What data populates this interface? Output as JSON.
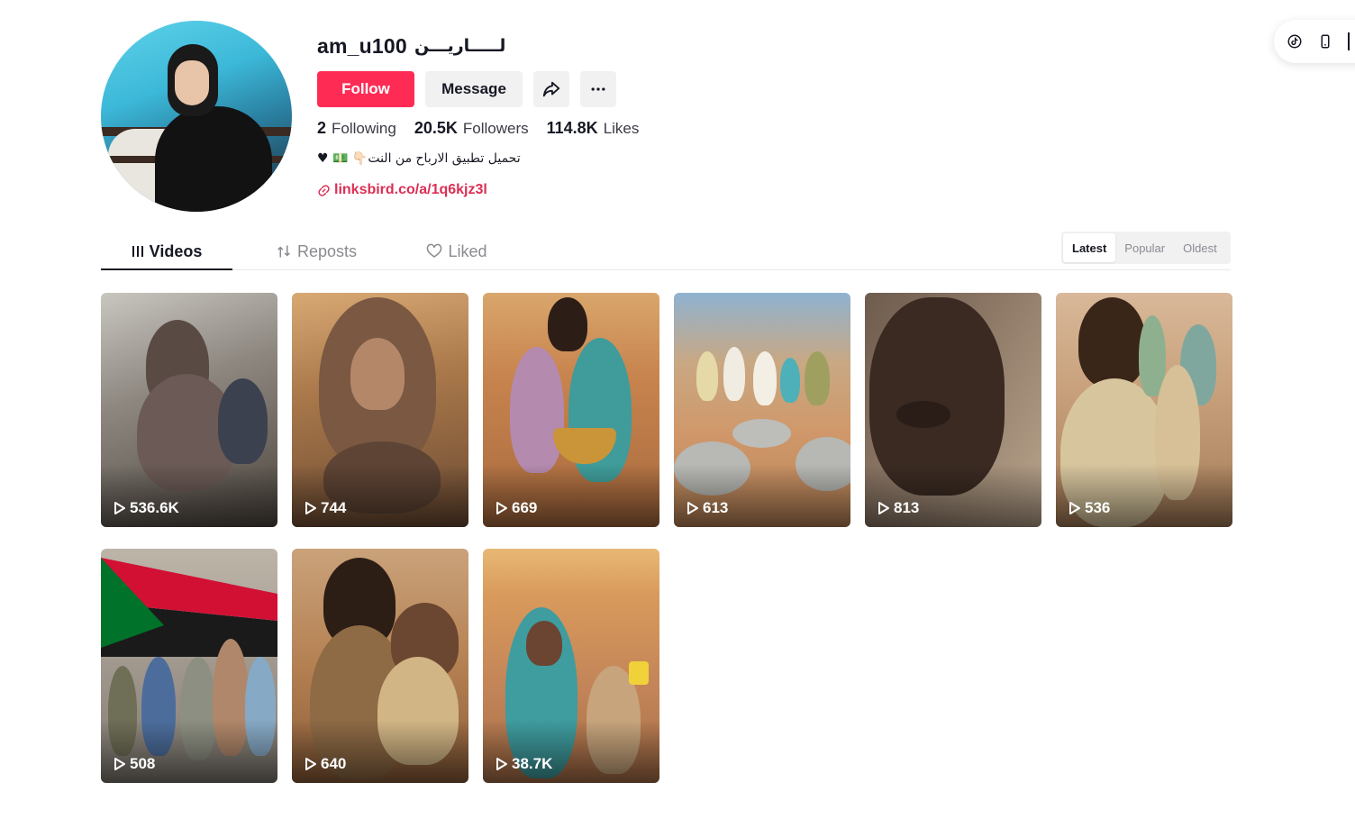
{
  "profile": {
    "username": "am_u100",
    "nickname": "لـــــاريـــن",
    "follow_label": "Follow",
    "message_label": "Message",
    "share_icon": "share-icon",
    "more_icon": "more-icon",
    "stats": {
      "following_count": "2",
      "following_label": "Following",
      "followers_count": "20.5K",
      "followers_label": "Followers",
      "likes_count": "114.8K",
      "likes_label": "Likes"
    },
    "bio": "♥ 💵 👇🏻تحميل تطبيق الارباح من النت",
    "link": "linksbird.co/a/1q6kjz3l"
  },
  "tabs": {
    "videos": "Videos",
    "reposts": "Reposts",
    "liked": "Liked"
  },
  "sort": {
    "latest": "Latest",
    "popular": "Popular",
    "oldest": "Oldest",
    "selected": "Latest"
  },
  "videos": [
    {
      "views": "536.6K"
    },
    {
      "views": "744"
    },
    {
      "views": "669"
    },
    {
      "views": "613"
    },
    {
      "views": "813"
    },
    {
      "views": "536"
    },
    {
      "views": "508"
    },
    {
      "views": "640"
    },
    {
      "views": "38.7K"
    }
  ],
  "floating": {
    "icons": [
      "tiktok-icon",
      "mobile-icon"
    ]
  },
  "colors": {
    "accent": "#fe2c55",
    "link": "#dc2f55",
    "button_gray": "#f1f1f2"
  }
}
